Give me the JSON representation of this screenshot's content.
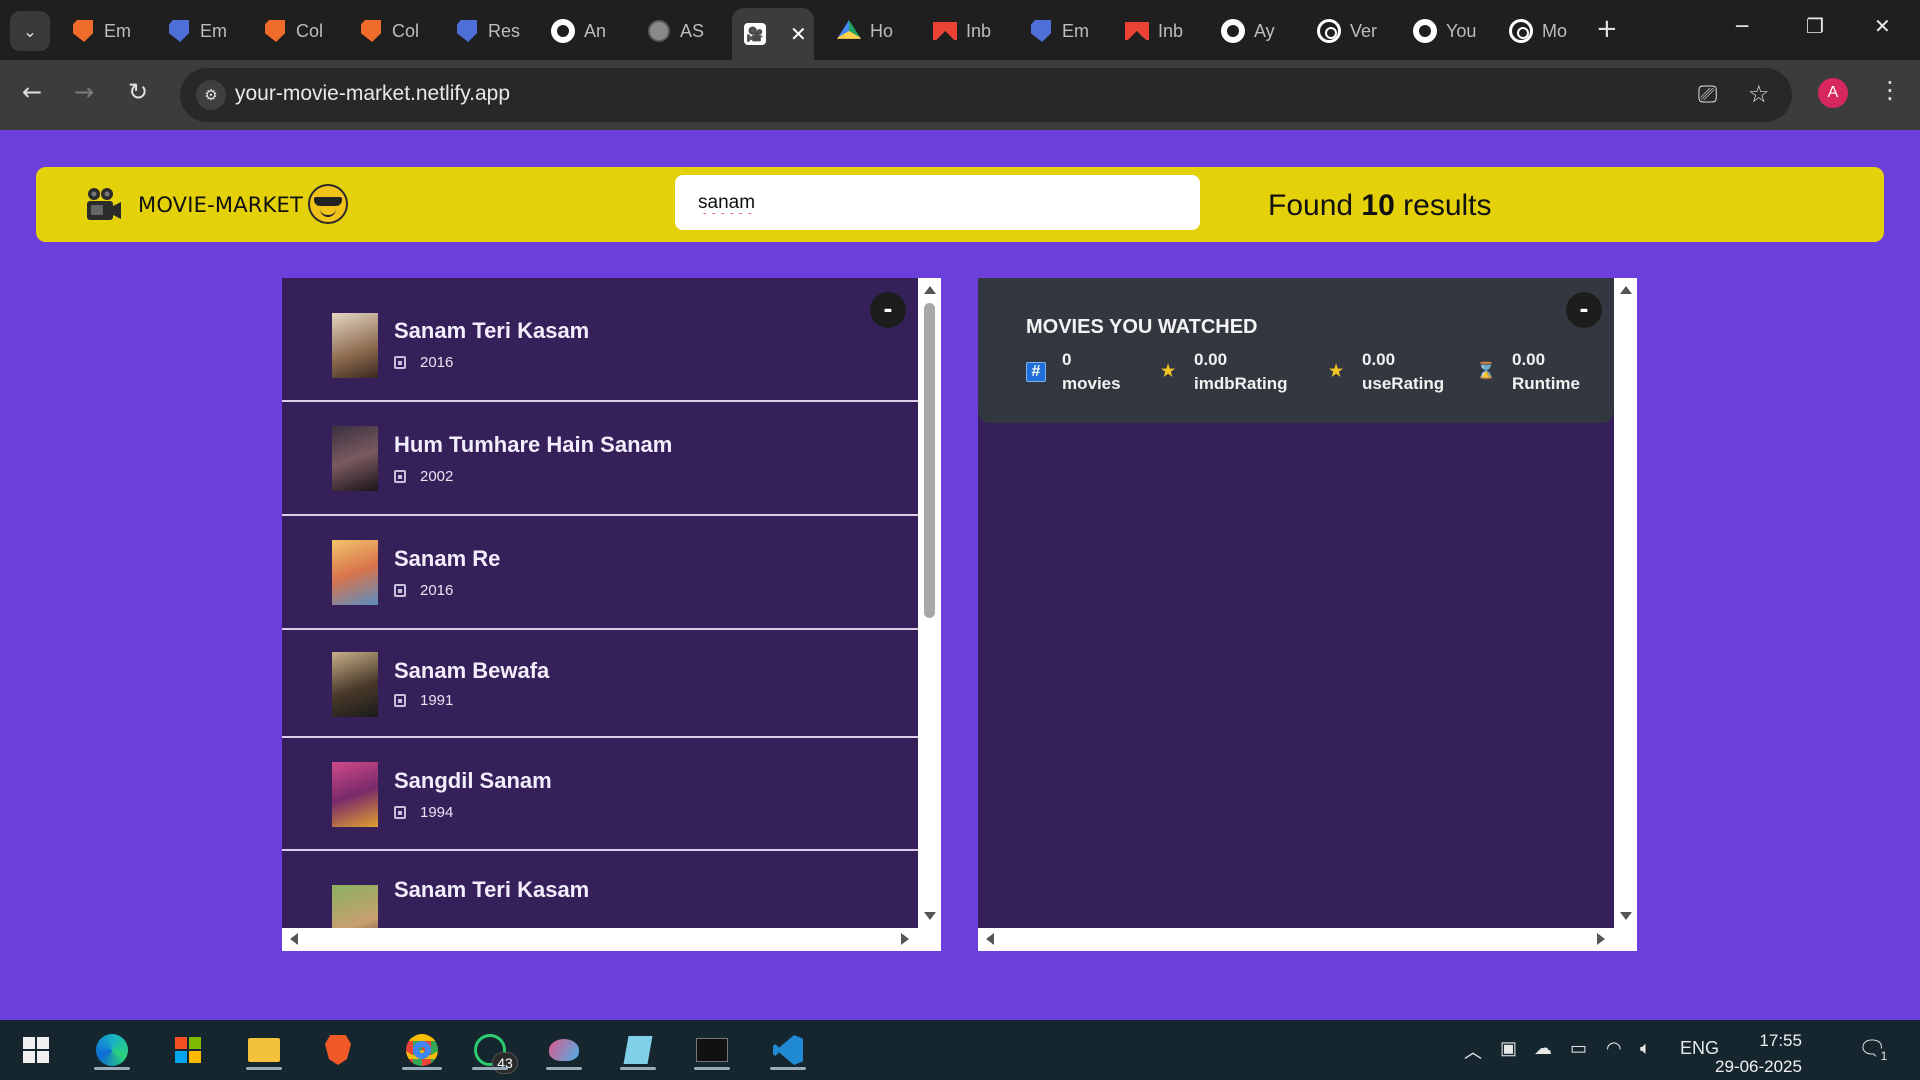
{
  "browser": {
    "tabs": [
      {
        "label": "Em",
        "icon": "brave-orange-icon"
      },
      {
        "label": "Em",
        "icon": "brave-blue-icon"
      },
      {
        "label": "Col",
        "icon": "brave-orange-icon"
      },
      {
        "label": "Col",
        "icon": "brave-orange-icon"
      },
      {
        "label": "Res",
        "icon": "brave-blue-icon"
      },
      {
        "label": "An",
        "icon": "github-icon"
      },
      {
        "label": "AS",
        "icon": "globe-icon"
      },
      {
        "label": "",
        "icon": "movie-market-icon",
        "active": true
      },
      {
        "label": "Ho",
        "icon": "google-drive-icon"
      },
      {
        "label": "Inb",
        "icon": "gmail-icon"
      },
      {
        "label": "Em",
        "icon": "brave-blue-icon"
      },
      {
        "label": "Inb",
        "icon": "gmail-icon"
      },
      {
        "label": "Ay",
        "icon": "github-icon"
      },
      {
        "label": "Ver",
        "icon": "chatgpt-icon"
      },
      {
        "label": "You",
        "icon": "github-icon"
      },
      {
        "label": "Mo",
        "icon": "chatgpt-icon"
      }
    ],
    "url": "your-movie-market.netlify.app",
    "profile_initial": "A"
  },
  "app": {
    "logo_text": "MOVIE-MARKET",
    "search_value": "sanam",
    "found_prefix": "Found",
    "found_count": "10",
    "found_suffix": "results",
    "toggle_label": "-",
    "movies": [
      {
        "title": "Sanam Teri Kasam",
        "year": "2016"
      },
      {
        "title": "Hum Tumhare Hain Sanam",
        "year": "2002"
      },
      {
        "title": "Sanam Re",
        "year": "2016"
      },
      {
        "title": "Sanam Bewafa",
        "year": "1991"
      },
      {
        "title": "Sangdil Sanam",
        "year": "1994"
      },
      {
        "title": "Sanam Teri Kasam",
        "year": ""
      }
    ],
    "summary": {
      "title": "MOVIES YOU WATCHED",
      "stats": [
        {
          "value": "0",
          "label": "movies",
          "icon": "hash-icon"
        },
        {
          "value": "0.00",
          "label": "imdbRating",
          "icon": "star-icon"
        },
        {
          "value": "0.00",
          "label": "useRating",
          "icon": "star-icon"
        },
        {
          "value": "0.00",
          "label": "Runtime",
          "icon": "hourglass-icon"
        }
      ]
    }
  },
  "taskbar": {
    "whatsapp_badge": "43",
    "language": "ENG",
    "time": "17:55",
    "date": "29-06-2025",
    "notifications": "1"
  },
  "colors": {
    "page_bg": "#6c3fdc",
    "header_bg": "#e5d10a",
    "list_bg": "#36205a",
    "summary_bg": "#333740"
  }
}
